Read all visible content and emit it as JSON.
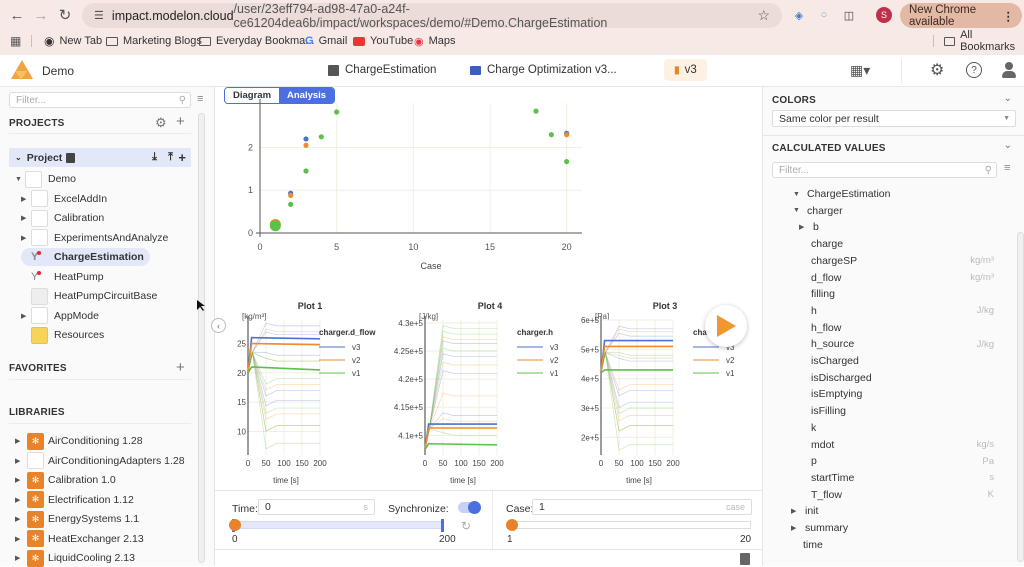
{
  "browser": {
    "url_host": "impact.modelon.cloud",
    "url_path": "/user/23eff794-ad98-47a0-a24f-ce61204dea6b/impact/workspaces/demo/#Demo.ChargeEstimation",
    "new_chrome_label": "New Chrome available",
    "profile_initial": "S",
    "bookmarks": [
      "New Tab",
      "Marketing Blogs",
      "Everyday Bookma...",
      "Gmail",
      "YouTube",
      "Maps"
    ],
    "all_bookmarks": "All Bookmarks"
  },
  "app": {
    "workspace": "Demo",
    "tabs": [
      {
        "label": "ChargeEstimation",
        "icon": "model-icon"
      },
      {
        "label": "Charge Optimization v3...",
        "icon": "experiment-icon"
      },
      {
        "label": "v3",
        "icon": "bar-chart-icon",
        "active": true
      }
    ]
  },
  "left": {
    "filter_placeholder": "Filter...",
    "projects_title": "PROJECTS",
    "project_label": "Project",
    "project_tree": [
      {
        "label": "Demo",
        "level": 0,
        "expand": "open",
        "icon": "box"
      },
      {
        "label": "ExcelAddIn",
        "level": 1,
        "expand": "closed",
        "icon": "box"
      },
      {
        "label": "Calibration",
        "level": 1,
        "expand": "closed",
        "icon": "box"
      },
      {
        "label": "ExperimentsAndAnalyze",
        "level": 1,
        "expand": "closed",
        "icon": "box"
      },
      {
        "label": "ChargeEstimation",
        "level": 1,
        "expand": "none",
        "icon": "model",
        "selected": true
      },
      {
        "label": "HeatPump",
        "level": 1,
        "expand": "none",
        "icon": "model"
      },
      {
        "label": "HeatPumpCircuitBase",
        "level": 1,
        "expand": "none",
        "icon": "gray-box"
      },
      {
        "label": "AppMode",
        "level": 1,
        "expand": "closed",
        "icon": "box"
      },
      {
        "label": "Resources",
        "level": 1,
        "expand": "none",
        "icon": "folder"
      }
    ],
    "favorites_title": "FAVORITES",
    "libraries_title": "LIBRARIES",
    "libraries": [
      {
        "label": "AirConditioning 1.28",
        "icon": "orange"
      },
      {
        "label": "AirConditioningAdapters 1.28",
        "icon": "blank"
      },
      {
        "label": "Calibration 1.0",
        "icon": "orange"
      },
      {
        "label": "Electrification 1.12",
        "icon": "orange"
      },
      {
        "label": "EnergySystems 1.1",
        "icon": "orange"
      },
      {
        "label": "HeatExchanger 2.13",
        "icon": "orange"
      },
      {
        "label": "LiquidCooling 2.13",
        "icon": "orange"
      }
    ]
  },
  "center": {
    "view_toggle": {
      "diagram": "Diagram",
      "analysis": "Analysis",
      "active": "Analysis"
    },
    "controls": {
      "time_label": "Time:",
      "time_value": "0",
      "time_unit": "s",
      "synchronize_label": "Synchronize:",
      "synchronize_on": true,
      "time_min": "0",
      "time_max": "200",
      "time_fraction": 0,
      "case_label": "Case:",
      "case_value": "1",
      "case_unit": "case",
      "case_min": "1",
      "case_max": "20",
      "case_fraction": 0
    }
  },
  "right": {
    "colors_title": "COLORS",
    "colors_select": "Same color per result",
    "calc_title": "CALCULATED VALUES",
    "filter_placeholder": "Filter...",
    "tree": [
      {
        "label": "ChargeEstimation",
        "level": 0,
        "expand": "open"
      },
      {
        "label": "charger",
        "level": 1,
        "expand": "open"
      },
      {
        "label": "b",
        "level": 2,
        "expand": "closed"
      },
      {
        "label": "charge",
        "level": 2,
        "expand": "none",
        "unit": ""
      },
      {
        "label": "chargeSP",
        "level": 2,
        "expand": "none",
        "unit": "kg/m³"
      },
      {
        "label": "d_flow",
        "level": 2,
        "expand": "none",
        "unit": "kg/m³"
      },
      {
        "label": "filling",
        "level": 2,
        "expand": "none",
        "unit": ""
      },
      {
        "label": "h",
        "level": 2,
        "expand": "none",
        "unit": "J/kg"
      },
      {
        "label": "h_flow",
        "level": 2,
        "expand": "none",
        "unit": ""
      },
      {
        "label": "h_source",
        "level": 2,
        "expand": "none",
        "unit": "J/kg"
      },
      {
        "label": "isCharged",
        "level": 2,
        "expand": "none",
        "unit": ""
      },
      {
        "label": "isDischarged",
        "level": 2,
        "expand": "none",
        "unit": ""
      },
      {
        "label": "isEmptying",
        "level": 2,
        "expand": "none",
        "unit": ""
      },
      {
        "label": "isFilling",
        "level": 2,
        "expand": "none",
        "unit": ""
      },
      {
        "label": "k",
        "level": 2,
        "expand": "none",
        "unit": ""
      },
      {
        "label": "mdot",
        "level": 2,
        "expand": "none",
        "unit": "kg/s"
      },
      {
        "label": "p",
        "level": 2,
        "expand": "none",
        "unit": "Pa"
      },
      {
        "label": "startTime",
        "level": 2,
        "expand": "none",
        "unit": "s"
      },
      {
        "label": "T_flow",
        "level": 2,
        "expand": "none",
        "unit": "K"
      },
      {
        "label": "init",
        "level": 1,
        "expand": "closed"
      },
      {
        "label": "summary",
        "level": 1,
        "expand": "closed"
      },
      {
        "label": "time",
        "level": 0,
        "expand": "none"
      }
    ]
  },
  "chart_data": [
    {
      "type": "scatter",
      "title": "",
      "xlabel": "Case",
      "ylabel": "",
      "xlim": [
        0,
        21
      ],
      "ylim": [
        0,
        2.9
      ],
      "xticks": [
        0,
        5,
        10,
        15,
        20
      ],
      "yticks": [
        0,
        1,
        2
      ],
      "grid": true,
      "series": [
        {
          "name": "v3",
          "color": "#4a74c9",
          "points": [
            [
              2,
              0.93
            ],
            [
              3,
              2.2
            ],
            [
              20,
              2.33
            ]
          ]
        },
        {
          "name": "v2",
          "color": "#f08a2c",
          "points": [
            [
              1,
              0.2
            ],
            [
              2,
              0.88
            ],
            [
              3,
              2.05
            ],
            [
              20,
              2.3
            ]
          ]
        },
        {
          "name": "v1",
          "color": "#5cc04a",
          "points": [
            [
              1,
              0.17
            ],
            [
              2,
              0.67
            ],
            [
              3,
              1.45
            ],
            [
              4,
              2.25
            ],
            [
              5,
              2.83
            ],
            [
              18,
              2.85
            ],
            [
              19,
              2.3
            ],
            [
              20,
              1.67
            ]
          ]
        }
      ]
    },
    {
      "type": "line",
      "title": "Plot 1",
      "unit": "[kg/m³]",
      "xlabel": "time [s]",
      "xlim": [
        0,
        200
      ],
      "xticks": [
        0,
        50,
        100,
        150,
        200
      ],
      "ylim": [
        6,
        29
      ],
      "yticks": [
        10,
        15,
        20,
        25
      ],
      "ytick_labels": [
        "10",
        "15",
        "20",
        "25"
      ],
      "legend_title": "charger.d_flow",
      "legend": [
        {
          "name": "v3",
          "color": "#4a74c9"
        },
        {
          "name": "v2",
          "color": "#f08a2c"
        },
        {
          "name": "v1",
          "color": "#5cc04a"
        }
      ],
      "series": [
        {
          "name": "v3",
          "start": 20,
          "peak": 26,
          "final": 25.8
        },
        {
          "name": "v2",
          "start": 20,
          "peak": 25,
          "final": 24.8
        },
        {
          "name": "v1",
          "start": 20,
          "peak": 21,
          "final": 20.5
        }
      ],
      "faint_finals": {
        "v3": [
          28,
          26.5,
          23,
          17,
          15.3
        ],
        "v2": [
          27,
          22,
          18,
          13,
          11
        ],
        "v1": [
          22,
          19,
          14,
          11,
          8
        ]
      }
    },
    {
      "type": "line",
      "title": "Plot 4",
      "unit": "[J/kg]",
      "xlabel": "time [s]",
      "xlim": [
        0,
        200
      ],
      "xticks": [
        0,
        50,
        100,
        150,
        200
      ],
      "ylim": [
        406500,
        430500
      ],
      "yticks": [
        410000,
        415000,
        420000,
        425000,
        430000
      ],
      "ytick_labels": [
        "4.1e+5",
        "4.15e+5",
        "4.2e+5",
        "4.25e+5",
        "4.3e+5"
      ],
      "legend_title": "charger.h",
      "legend": [
        {
          "name": "v3",
          "color": "#4a74c9"
        },
        {
          "name": "v2",
          "color": "#f08a2c"
        },
        {
          "name": "v1",
          "color": "#5cc04a"
        }
      ],
      "series": [
        {
          "name": "v3",
          "start": 407500,
          "peak": 412000,
          "final": 412000
        },
        {
          "name": "v2",
          "start": 407500,
          "peak": 411300,
          "final": 411300
        },
        {
          "name": "v1",
          "start": 407500,
          "peak": 408500,
          "final": 408300
        }
      ],
      "faint_finals": {
        "v3": [
          426300,
          424000,
          421000,
          413500
        ],
        "v2": [
          427000,
          422500,
          417000,
          412500
        ],
        "v1": [
          429000,
          428000,
          425000,
          410000
        ]
      }
    },
    {
      "type": "line",
      "title": "Plot 3",
      "unit": "[Pa]",
      "xlabel": "time [s]",
      "xlim": [
        0,
        200
      ],
      "xticks": [
        0,
        50,
        100,
        150,
        200
      ],
      "ylim": [
        140000,
        600000
      ],
      "yticks": [
        200000,
        300000,
        400000,
        500000,
        600000
      ],
      "ytick_labels": [
        "2e+5",
        "3e+5",
        "4e+5",
        "5e+5",
        "6e+5"
      ],
      "legend_title": "charger.h",
      "legend": [
        {
          "name": "v3",
          "color": "#4a74c9"
        },
        {
          "name": "v2",
          "color": "#f08a2c"
        },
        {
          "name": "v1",
          "color": "#5cc04a"
        }
      ],
      "series": [
        {
          "name": "v3",
          "start": 420000,
          "peak": 530000,
          "final": 530000
        },
        {
          "name": "v2",
          "start": 420000,
          "peak": 510000,
          "final": 510000
        },
        {
          "name": "v1",
          "start": 420000,
          "peak": 430000,
          "final": 430000
        }
      ],
      "faint_finals": {
        "v3": [
          570000,
          545000,
          460000,
          360000,
          320000
        ],
        "v2": [
          560000,
          470000,
          380000,
          275000,
          240000
        ],
        "v1": [
          480000,
          300000,
          240000,
          175000
        ]
      }
    }
  ]
}
